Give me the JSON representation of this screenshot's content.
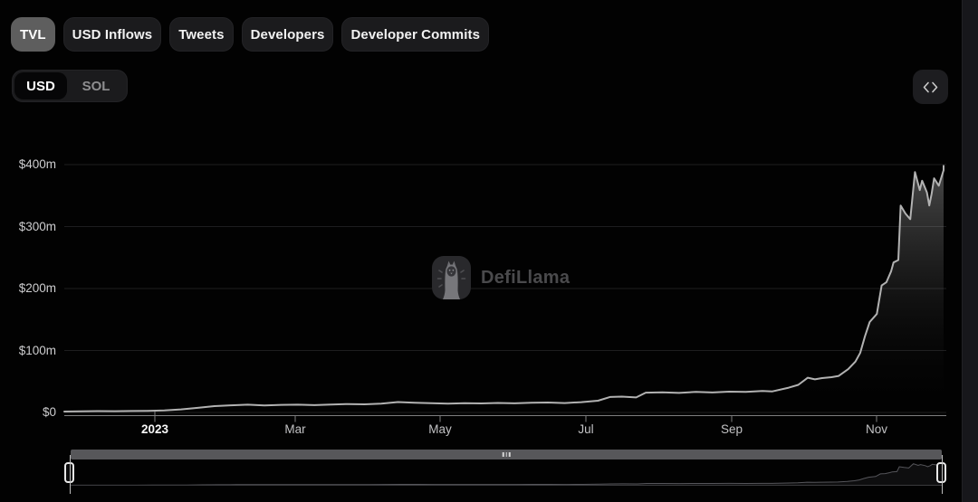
{
  "tabs": [
    {
      "label": "TVL",
      "active": true
    },
    {
      "label": "USD Inflows",
      "active": false
    },
    {
      "label": "Tweets",
      "active": false
    },
    {
      "label": "Developers",
      "active": false
    },
    {
      "label": "Developer Commits",
      "active": false
    }
  ],
  "currency_toggle": {
    "options": [
      "USD",
      "SOL"
    ],
    "selected": "USD"
  },
  "embed_button": {
    "icon": "code-icon"
  },
  "watermark": {
    "icon": "defillama-logo-icon",
    "label": "DefiLlama"
  },
  "colors": {
    "background": "#020202",
    "pill_inactive": "#1b1b1d",
    "pill_active": "#5e5e5e",
    "line": "#b2b2b2",
    "grid": "#1d1d1f",
    "axis": "#7d7d7f",
    "scrollbar": "#57575a",
    "handle_border": "#e8e8e8",
    "watermark_text": "#4a4a4c"
  },
  "chart_data": {
    "type": "area",
    "title": "TVL (USD)",
    "unit": "USD millions",
    "ylim": [
      0,
      400
    ],
    "yticks": [
      "$400m",
      "$300m",
      "$200m",
      "$100m",
      "$0"
    ],
    "xticks": [
      "2023",
      "Mar",
      "May",
      "Jul",
      "Sep",
      "Nov"
    ],
    "xtick_dates": [
      "2023-01-01",
      "2023-03-01",
      "2023-05-01",
      "2023-07-01",
      "2023-09-01",
      "2023-11-01"
    ],
    "xrange": [
      "2022-11-24",
      "2023-11-28"
    ],
    "grid": true,
    "legend": "none",
    "series": [
      {
        "name": "TVL",
        "points": [
          [
            "2022-11-24",
            1.5
          ],
          [
            "2022-12-01",
            1.8
          ],
          [
            "2022-12-08",
            2.2
          ],
          [
            "2022-12-15",
            2.0
          ],
          [
            "2022-12-22",
            2.3
          ],
          [
            "2022-12-29",
            2.5
          ],
          [
            "2023-01-05",
            3.2
          ],
          [
            "2023-01-12",
            5.0
          ],
          [
            "2023-01-19",
            7.5
          ],
          [
            "2023-01-26",
            10.2
          ],
          [
            "2023-02-02",
            11.5
          ],
          [
            "2023-02-09",
            12.5
          ],
          [
            "2023-02-16",
            11.2
          ],
          [
            "2023-02-23",
            12.2
          ],
          [
            "2023-03-02",
            12.6
          ],
          [
            "2023-03-09",
            11.8
          ],
          [
            "2023-03-16",
            12.9
          ],
          [
            "2023-03-23",
            13.6
          ],
          [
            "2023-03-30",
            13.1
          ],
          [
            "2023-04-06",
            14.2
          ],
          [
            "2023-04-13",
            16.8
          ],
          [
            "2023-04-20",
            15.6
          ],
          [
            "2023-04-27",
            14.9
          ],
          [
            "2023-05-04",
            14.2
          ],
          [
            "2023-05-11",
            15.1
          ],
          [
            "2023-05-18",
            14.6
          ],
          [
            "2023-05-25",
            15.4
          ],
          [
            "2023-06-01",
            14.7
          ],
          [
            "2023-06-08",
            15.6
          ],
          [
            "2023-06-15",
            16.1
          ],
          [
            "2023-06-22",
            15.2
          ],
          [
            "2023-06-29",
            16.6
          ],
          [
            "2023-07-06",
            19.0
          ],
          [
            "2023-07-11",
            25.0
          ],
          [
            "2023-07-16",
            25.6
          ],
          [
            "2023-07-22",
            24.2
          ],
          [
            "2023-07-26",
            32.0
          ],
          [
            "2023-08-02",
            32.6
          ],
          [
            "2023-08-09",
            31.6
          ],
          [
            "2023-08-16",
            33.1
          ],
          [
            "2023-08-23",
            32.2
          ],
          [
            "2023-08-30",
            33.6
          ],
          [
            "2023-09-06",
            33.2
          ],
          [
            "2023-09-13",
            34.6
          ],
          [
            "2023-09-17",
            33.8
          ],
          [
            "2023-09-24",
            40.0
          ],
          [
            "2023-09-28",
            44.5
          ],
          [
            "2023-10-02",
            56.0
          ],
          [
            "2023-10-05",
            53.5
          ],
          [
            "2023-10-08",
            55.5
          ],
          [
            "2023-10-12",
            57.0
          ],
          [
            "2023-10-15",
            59.0
          ],
          [
            "2023-10-19",
            70.0
          ],
          [
            "2023-10-22",
            82.0
          ],
          [
            "2023-10-24",
            96.0
          ],
          [
            "2023-10-26",
            123.0
          ],
          [
            "2023-10-28",
            146.0
          ],
          [
            "2023-10-31",
            159.0
          ],
          [
            "2023-11-02",
            205.0
          ],
          [
            "2023-11-04",
            210.0
          ],
          [
            "2023-11-06",
            228.0
          ],
          [
            "2023-11-07",
            242.0
          ],
          [
            "2023-11-09",
            246.0
          ],
          [
            "2023-11-10",
            334.0
          ],
          [
            "2023-11-12",
            321.0
          ],
          [
            "2023-11-14",
            312.0
          ],
          [
            "2023-11-16",
            388.0
          ],
          [
            "2023-11-18",
            359.0
          ],
          [
            "2023-11-19",
            374.0
          ],
          [
            "2023-11-21",
            355.0
          ],
          [
            "2023-11-22",
            334.0
          ],
          [
            "2023-11-23",
            353.0
          ],
          [
            "2023-11-24",
            378.0
          ],
          [
            "2023-11-26",
            366.0
          ],
          [
            "2023-11-28",
            391.0
          ],
          [
            "2023-11-28",
            398.0
          ]
        ]
      }
    ]
  },
  "brush": {
    "full_range_selected": true
  }
}
